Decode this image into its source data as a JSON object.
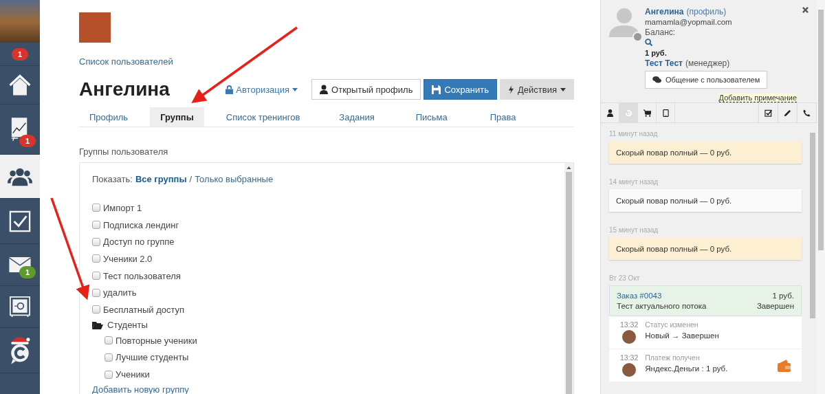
{
  "sidebar": {
    "top_badge": {
      "text": "1",
      "color": "#d9342b"
    },
    "items": [
      {
        "kind": "home",
        "selected": false
      },
      {
        "kind": "chart",
        "selected": false,
        "badge": {
          "text": "1",
          "color": "#d9342b"
        }
      },
      {
        "kind": "users",
        "selected": true
      },
      {
        "kind": "tasks",
        "selected": false
      },
      {
        "kind": "mail",
        "selected": false,
        "badge": {
          "text": "1",
          "color": "#5f9a2c"
        }
      },
      {
        "kind": "safe",
        "selected": false
      },
      {
        "kind": "logo",
        "selected": false
      }
    ]
  },
  "main": {
    "breadcrumb": "Список пользователей",
    "title": "Ангелина",
    "auth_link": "Авторизация",
    "buttons": [
      {
        "kind": "profile",
        "label": "Открытый профиль"
      },
      {
        "kind": "save",
        "label": "Сохранить"
      },
      {
        "kind": "actions",
        "label": "Действия"
      }
    ],
    "tabs": [
      {
        "label": "Профиль",
        "selected": false
      },
      {
        "label": "Группы",
        "selected": true
      },
      {
        "label": "Список тренингов",
        "selected": false
      },
      {
        "label": "Задания",
        "selected": false
      },
      {
        "label": "Письма",
        "selected": false
      },
      {
        "label": "Права",
        "selected": false
      }
    ],
    "section_title": "Группы пользователя",
    "filter": {
      "label": "Показать:",
      "separator": "/",
      "options": [
        {
          "label": "Все группы",
          "selected": true
        },
        {
          "label": "Только выбранные",
          "selected": false
        }
      ]
    },
    "groups": [
      {
        "kind": "checkbox",
        "label": "Импорт 1",
        "checked": false
      },
      {
        "kind": "checkbox",
        "label": "Подписка лендинг",
        "checked": false
      },
      {
        "kind": "checkbox",
        "label": "Доступ по группе",
        "checked": false
      },
      {
        "kind": "checkbox",
        "label": "Ученики 2.0",
        "checked": false
      },
      {
        "kind": "checkbox",
        "label": "Тест пользователя",
        "checked": false
      },
      {
        "kind": "checkbox",
        "label": "удалить",
        "checked": false
      },
      {
        "kind": "checkbox",
        "label": "Бесплатный доступ",
        "checked": false
      },
      {
        "kind": "folder",
        "label": "Студенты",
        "children": [
          {
            "kind": "checkbox",
            "label": "Повторные ученики",
            "checked": false
          },
          {
            "kind": "checkbox",
            "label": "Лучшие студенты",
            "checked": false
          },
          {
            "kind": "checkbox",
            "label": "Ученики",
            "checked": false
          }
        ]
      }
    ],
    "add_link": "Добавить новую группу"
  },
  "panel": {
    "name": "Ангелина",
    "profile_link": "(профиль)",
    "email": "mamamla@yopmail.com",
    "balance_label": "Баланс:",
    "balance": "1 руб.",
    "manager": "Тест Тест",
    "manager_role": "(менеджер)",
    "chat_button": "Общение с пользователем",
    "add_note": "Добавить примечание",
    "tabs": [
      {
        "kind": "user",
        "selected": false
      },
      {
        "kind": "history",
        "selected": true
      },
      {
        "kind": "cart",
        "selected": false
      },
      {
        "kind": "tablet",
        "selected": false
      }
    ],
    "tools": [
      {
        "kind": "check"
      },
      {
        "kind": "pencil"
      },
      {
        "kind": "phone"
      }
    ],
    "feed": [
      {
        "time": "11 минут назад",
        "text": "Скорый повар полный — 0 руб.",
        "highlighted": true
      },
      {
        "time": "14 минут назад",
        "text": "Скорый повар полный — 0 руб.",
        "highlighted": false
      },
      {
        "time": "15 минут назад",
        "text": "Скорый повар полный — 0 руб.",
        "highlighted": true
      }
    ],
    "order": {
      "date": "Вт 23 Окт",
      "title": "Заказ #0043",
      "amount": "1 руб.",
      "subtitle": "Тест актуального потока",
      "status": "Завершен",
      "events": [
        {
          "time": "13:32",
          "label": "Статус изменен",
          "text": "Новый → Завершен",
          "kind": "status"
        },
        {
          "time": "13:32",
          "label": "Платеж получен",
          "text": "Яндекс.Деньги : 1 руб.",
          "kind": "payment"
        }
      ]
    }
  }
}
